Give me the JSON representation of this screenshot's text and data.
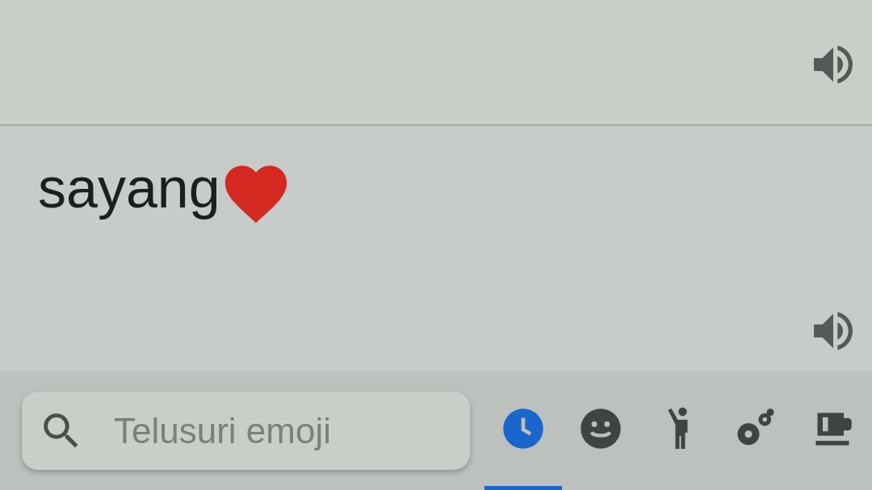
{
  "panels": [
    {
      "kind": "audio_only"
    },
    {
      "kind": "text",
      "text": "sayang"
    }
  ],
  "emoji_bar": {
    "search": {
      "placeholder": "Telusuri emoji"
    },
    "categories": [
      {
        "kind": "recent",
        "selected": true
      },
      {
        "kind": "smileys",
        "selected": false
      },
      {
        "kind": "people",
        "selected": false
      },
      {
        "kind": "nature",
        "selected": false
      },
      {
        "kind": "food",
        "selected": false
      }
    ]
  }
}
